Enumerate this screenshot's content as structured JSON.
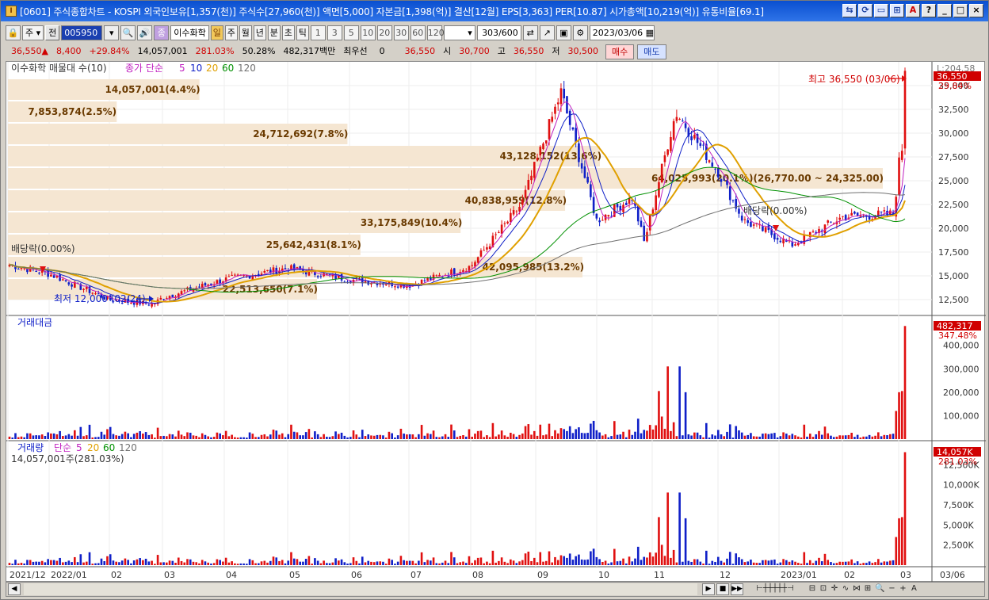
{
  "window": {
    "title": "[0601] 주식종합차트 - KOSPI 외국인보유[1,357(천)] 주식수[27,960(천)] 액면[5,000] 자본금[1,398(억)] 결산[12월] EPS[3,363] PER[10.87] 시가총액[10,219(억)] 유통비율[69.1]",
    "app_icon": "I",
    "title_buttons": [
      "chart-link-icon",
      "refresh-icon",
      "window-icon",
      "link-icon",
      "font-a-icon",
      "help-icon",
      "minimize-icon",
      "maximize-icon",
      "close-icon"
    ],
    "title_button_glyphs": [
      "⇆",
      "⟳",
      "▭",
      "⊞",
      "A",
      "?",
      "_",
      "□",
      "×"
    ]
  },
  "toolbar": {
    "type_select": "주",
    "prev_label": "전",
    "code_value": "005950",
    "name_value": "이수화학",
    "periods": [
      "일",
      "주",
      "월",
      "년",
      "분",
      "초",
      "틱"
    ],
    "active_period": "일",
    "intervals": [
      "1",
      "3",
      "5",
      "10",
      "20",
      "30",
      "60",
      "120"
    ],
    "count_value": "303",
    "count_total": "/600",
    "date_value": "2023/03/06"
  },
  "quote": {
    "price": "36,550",
    "arrow": "▲",
    "change": "8,400",
    "change_rate": "+29.84%",
    "volume": "14,057,001",
    "volume_ratio": "281.03%",
    "turnover": "50.28%",
    "amount": "482,317백만",
    "priority_label": "최우선",
    "priority_value": "0",
    "ask": "36,550",
    "open_label": "시",
    "open": "30,700",
    "high_label": "고",
    "high": "36,550",
    "low_label": "저",
    "low": "30,500",
    "buy_label": "매수",
    "sell_label": "매도"
  },
  "colors": {
    "up": "#e01010",
    "down": "#1020c8",
    "ma5": "#c020c0",
    "ma10": "#1020c8",
    "ma20": "#e0a000",
    "ma60": "#009000",
    "ma120": "#707070",
    "volume_profile": "#f5e6d2",
    "volume_profile_text": "#6a3a00"
  },
  "price_pane": {
    "legend_title": "이수화학 매물대 수(10)",
    "legend_ma_label": "종가 단순",
    "legend_periods": [
      "5",
      "10",
      "20",
      "60",
      "120"
    ],
    "current_price_tag": "36,550",
    "current_rate_tag": "29.84%",
    "top_label": "L:204.58",
    "y_ticks": [
      "35,000",
      "32,500",
      "30,000",
      "27,500",
      "25,000",
      "22,500",
      "20,000",
      "17,500",
      "15,000",
      "12,500"
    ],
    "volume_profile": [
      {
        "label": "14,057,001(4.4%)",
        "value_pct": 4.4
      },
      {
        "label": "7,853,874(2.5%)",
        "value_pct": 2.5
      },
      {
        "label": "24,712,692(7.8%)",
        "value_pct": 7.8
      },
      {
        "label": "43,128,152(13.6%)",
        "value_pct": 13.6
      },
      {
        "label": "64,025,993(20.1%)(26,770.00 ~ 24,325.00)",
        "value_pct": 20.1
      },
      {
        "label": "40,838,959(12.8%)",
        "value_pct": 12.8
      },
      {
        "label": "33,175,849(10.4%)",
        "value_pct": 10.4
      },
      {
        "label": "25,642,431(8.1%)",
        "value_pct": 8.1
      },
      {
        "label": "42,095,985(13.2%)",
        "value_pct": 13.2
      },
      {
        "label": "22,513,650(7.1%)",
        "value_pct": 7.1
      }
    ],
    "annotations": {
      "high": "최고 36,550 (03/06)",
      "low": "최저 12,000 (02/24)",
      "dividend_1": "배당락(0.00%)",
      "dividend_2": "배당락(0.00%)"
    }
  },
  "amount_pane": {
    "title": "거래대금",
    "tag_value": "482,317",
    "tag_rate": "347.48%",
    "y_ticks": [
      "400,000",
      "300,000",
      "200,000",
      "100,000"
    ]
  },
  "volume_pane": {
    "title": "거래량",
    "ma_label": "단순",
    "periods": [
      "5",
      "20",
      "60",
      "120"
    ],
    "current": "14,057,001주(281.03%)",
    "tag_value": "14,057K",
    "tag_rate": "281.03%",
    "y_ticks": [
      "12,500K",
      "10,000K",
      "7,500K",
      "5,000K",
      "2,500K"
    ]
  },
  "x_axis": {
    "labels": [
      "2021/12",
      "2022/01",
      "02",
      "03",
      "04",
      "05",
      "06",
      "07",
      "08",
      "09",
      "10",
      "11",
      "12",
      "2023/01",
      "02",
      "03"
    ],
    "end_label": "03/06"
  },
  "chart_data": {
    "type": "candlestick",
    "title": "이수화학",
    "unit": "원",
    "ylim": [
      11000,
      37000
    ],
    "close_series_anchors": [
      [
        "2021/12",
        16200
      ],
      [
        "2022/01",
        15200
      ],
      [
        "2022/02",
        12500
      ],
      [
        "2022/02/24",
        12000
      ],
      [
        "2022/03",
        12700
      ],
      [
        "2022/04",
        14600
      ],
      [
        "2022/05",
        15800
      ],
      [
        "2022/06",
        14600
      ],
      [
        "2022/07",
        14000
      ],
      [
        "2022/08",
        16000
      ],
      [
        "2022/08 end",
        22500
      ],
      [
        "2022/09 high",
        34300
      ],
      [
        "2022/10",
        20800
      ],
      [
        "2022/10 mid",
        23200
      ],
      [
        "2022/10 low",
        18500
      ],
      [
        "2022/11",
        29000
      ],
      [
        "2022/11 high",
        32200
      ],
      [
        "2022/12",
        26000
      ],
      [
        "2022/12 mid",
        20800
      ],
      [
        "2023/01",
        19000
      ],
      [
        "2023/01 low",
        18200
      ],
      [
        "2023/02",
        21200
      ],
      [
        "2023/02 end",
        21500
      ],
      [
        "2023/03/03",
        28150
      ],
      [
        "2023/03/06",
        36550
      ]
    ],
    "amount_peaks_million": [
      {
        "date": "2022/11",
        "value": 310000
      },
      {
        "date": "2022/11",
        "value": 310000
      },
      {
        "date": "2022/10",
        "value": 205000
      },
      {
        "date": "2023/03/02",
        "value": 205000
      },
      {
        "date": "2023/03/06",
        "value": 482317
      }
    ],
    "volume_peaks_k": [
      {
        "date": "2022/11",
        "value": 10600
      },
      {
        "date": "2022/11",
        "value": 10600
      },
      {
        "date": "2023/03/03",
        "value": 8800
      },
      {
        "date": "2023/03/06",
        "value": 14057
      }
    ]
  }
}
